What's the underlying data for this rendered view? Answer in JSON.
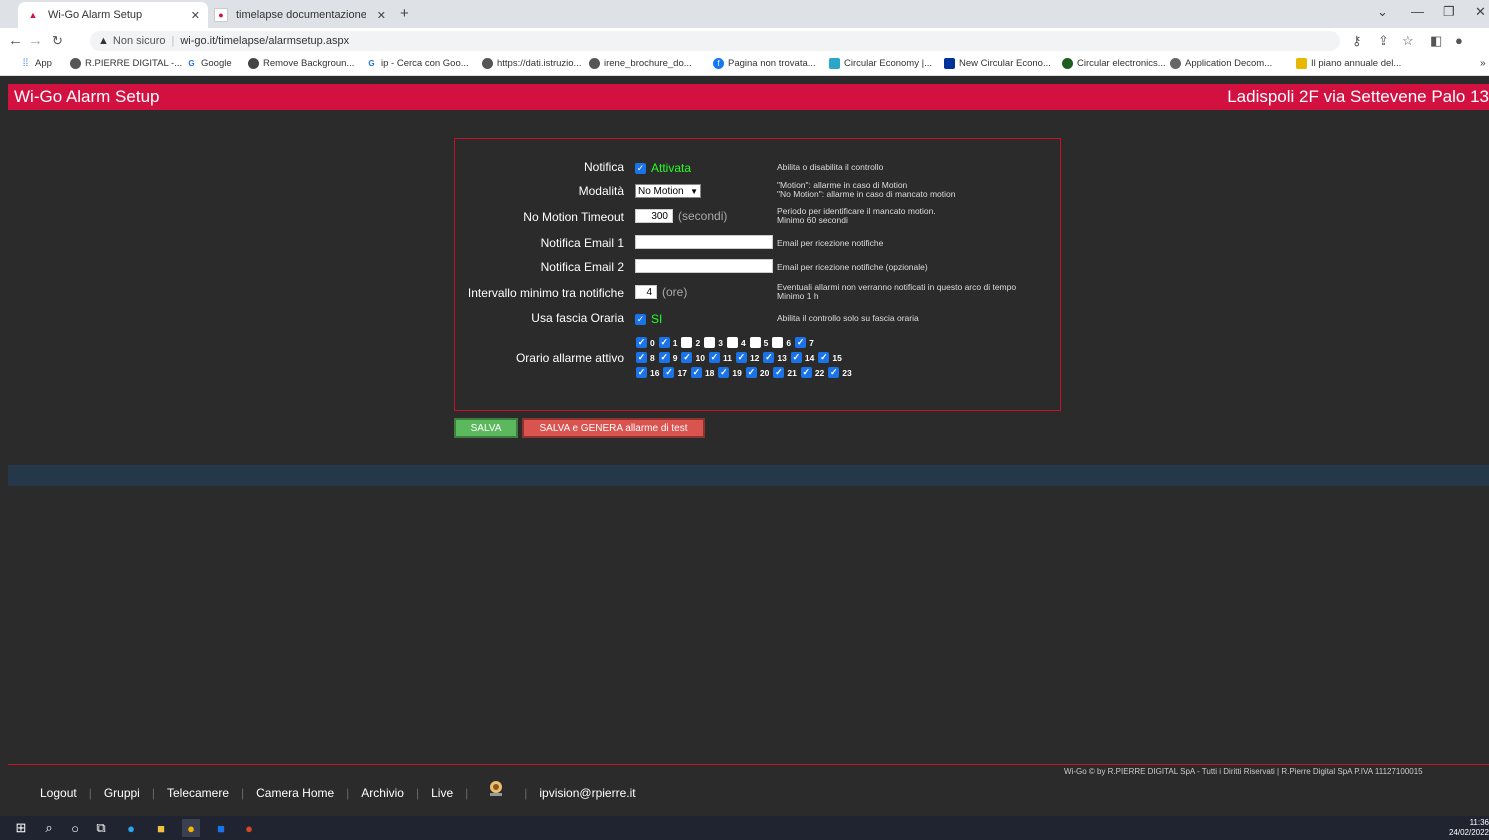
{
  "browser": {
    "tabs": [
      {
        "title": "Wi-Go Alarm Setup",
        "active": true
      },
      {
        "title": "timelapse documentazione per i",
        "active": false
      }
    ],
    "new_tab": "+",
    "security": "Non sicuro",
    "url": "wi-go.it/timelapse/alarmsetup.aspx",
    "bookmarks": [
      "App",
      "R.PIERRE DIGITAL -...",
      "Google",
      "Remove Backgroun...",
      "ip - Cerca con Goo...",
      "https://dati.istruzio...",
      "irene_brochure_do...",
      "Pagina non trovata...",
      "Circular Economy |...",
      "New Circular Econo...",
      "Circular electronics...",
      "Application Decom...",
      "Il piano annuale del..."
    ]
  },
  "header": {
    "title": "Wi-Go  Alarm Setup",
    "location": "Ladispoli 2F via Settevene Palo 13"
  },
  "form": {
    "notifica": {
      "label": "Notifica",
      "checked": true,
      "state": "Attivata",
      "help": "Abilita o disabilita il controllo"
    },
    "modalita": {
      "label": "Modalità",
      "value": "No Motion",
      "help1": "\"Motion\": allarme in caso di Motion",
      "help2": "\"No Motion\": allarme in caso di mancato motion"
    },
    "timeout": {
      "label": "No Motion Timeout",
      "value": "300",
      "unit": "(secondi)",
      "help1": "Periodo per identificare il mancato motion.",
      "help2": "Minimo 60 secondi"
    },
    "email1": {
      "label": "Notifica Email 1",
      "value": "",
      "help": "Email per ricezione notifiche"
    },
    "email2": {
      "label": "Notifica Email 2",
      "value": "",
      "help": "Email per ricezione notifiche (opzionale)"
    },
    "intervallo": {
      "label": "Intervallo minimo tra notifiche",
      "value": "4",
      "unit": "(ore)",
      "help1": "Eventuali allarmi non verranno notificati in questo arco di tempo",
      "help2": "Minimo 1 h"
    },
    "fascia": {
      "label": "Usa fascia Oraria",
      "checked": true,
      "state": "SI",
      "help": "Abilita il controllo solo su fascia oraria"
    },
    "orario": {
      "label": "Orario allarme attivo",
      "rows": [
        [
          {
            "h": "0",
            "on": true
          },
          {
            "h": "1",
            "on": true
          },
          {
            "h": "2",
            "on": false
          },
          {
            "h": "3",
            "on": false
          },
          {
            "h": "4",
            "on": false
          },
          {
            "h": "5",
            "on": false
          },
          {
            "h": "6",
            "on": false
          },
          {
            "h": "7",
            "on": true
          }
        ],
        [
          {
            "h": "8",
            "on": true
          },
          {
            "h": "9",
            "on": true
          },
          {
            "h": "10",
            "on": true
          },
          {
            "h": "11",
            "on": true
          },
          {
            "h": "12",
            "on": true
          },
          {
            "h": "13",
            "on": true
          },
          {
            "h": "14",
            "on": true
          },
          {
            "h": "15",
            "on": true
          }
        ],
        [
          {
            "h": "16",
            "on": true
          },
          {
            "h": "17",
            "on": true
          },
          {
            "h": "18",
            "on": true
          },
          {
            "h": "19",
            "on": true
          },
          {
            "h": "20",
            "on": true
          },
          {
            "h": "21",
            "on": true
          },
          {
            "h": "22",
            "on": true
          },
          {
            "h": "23",
            "on": true
          }
        ]
      ]
    }
  },
  "buttons": {
    "save": "SALVA",
    "save_test": "SALVA e GENERA allarme di test"
  },
  "footer": {
    "copyright": "Wi-Go © by R.PIERRE DIGITAL SpA - Tutti i Diritti Riservati | R.Pierre Digital SpA P.IVA 11127100015",
    "nav": [
      "Logout",
      "Gruppi",
      "Telecamere",
      "Camera Home",
      "Archivio",
      "Live"
    ],
    "user": "ipvision@rpierre.it"
  },
  "taskbar": {
    "time": "11:36",
    "date": "24/02/2022"
  },
  "colors": {
    "header_red": "#d21141",
    "panel_border": "#c8102e",
    "save_green": "#5cb85c",
    "test_red": "#d9534f",
    "bar_blue": "#24384a",
    "active_green": "#22ff22"
  }
}
